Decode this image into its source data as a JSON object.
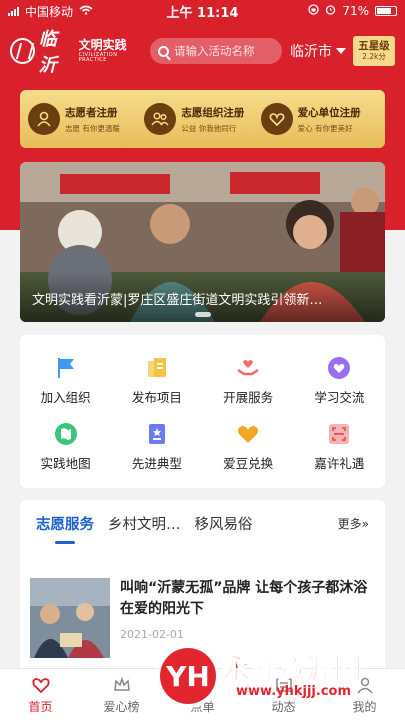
{
  "status_bar": {
    "carrier": "中国移动",
    "time": "上午 11:14",
    "battery": "71%"
  },
  "header": {
    "logo_title": "临沂",
    "logo_subtitle": "文明实践",
    "logo_caption": "CIVILIZATION PRACTICE",
    "search_placeholder": "请输入活动名称",
    "city": "临沂市",
    "level": "五星级",
    "points": "2.2k分"
  },
  "registration": [
    {
      "title": "志愿者注册",
      "subtitle": "志愿 有你更温暖",
      "icon": "user-heart-icon"
    },
    {
      "title": "志愿组织注册",
      "subtitle": "公益 你我他同行",
      "icon": "group-icon"
    },
    {
      "title": "爱心单位注册",
      "subtitle": "爱心 有你更美好",
      "icon": "heart-icon"
    }
  ],
  "banner": {
    "caption": "文明实践看沂蒙|罗庄区盛庄街道文明实践引领新…"
  },
  "services": [
    {
      "label": "加入组织",
      "icon": "flag-icon",
      "color": "#3a9bf0"
    },
    {
      "label": "发布项目",
      "icon": "document-icon",
      "color": "#f5c242"
    },
    {
      "label": "开展服务",
      "icon": "helping-hands-icon",
      "color": "#f06a6a"
    },
    {
      "label": "学习交流",
      "icon": "heart-chat-icon",
      "color": "#9b6df0"
    },
    {
      "label": "实践地图",
      "icon": "map-icon",
      "color": "#3cc47c"
    },
    {
      "label": "先进典型",
      "icon": "medal-icon",
      "color": "#6a7cf0"
    },
    {
      "label": "爱豆兑换",
      "icon": "love-bean-icon",
      "color": "#f5a623"
    },
    {
      "label": "嘉许礼遇",
      "icon": "scan-icon",
      "color": "#f07a7a"
    }
  ],
  "news": {
    "tabs": [
      "志愿服务",
      "乡村文明…",
      "移风易俗"
    ],
    "more": "更多»",
    "item": {
      "title": "叫响“沂蒙无孤”品牌 让每个孩子都沐浴在爱的阳光下",
      "date": "2021-02-01"
    }
  },
  "tabbar": [
    {
      "label": "首页",
      "icon": "home-heart-icon",
      "active": true
    },
    {
      "label": "爱心榜",
      "icon": "crown-icon",
      "active": false
    },
    {
      "label": "点单",
      "icon": "order-icon",
      "active": false
    },
    {
      "label": "动态",
      "icon": "news-icon",
      "active": false
    },
    {
      "label": "我的",
      "icon": "user-icon",
      "active": false
    }
  ],
  "watermark": {
    "text": "永辉资源网",
    "url": "www.yhkjjj.com"
  },
  "colors": {
    "brand_red": "#d9212b",
    "gold": "#f6dc8c",
    "tab_active": "#1e63c8"
  }
}
